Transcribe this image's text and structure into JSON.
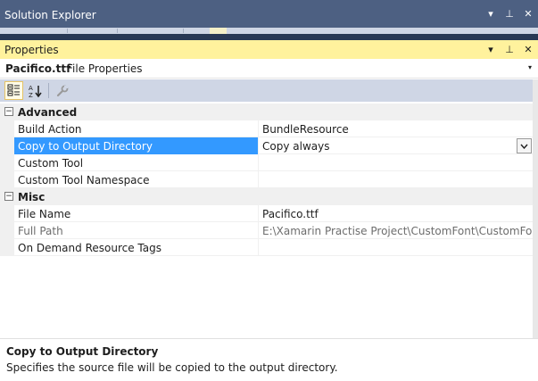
{
  "solution_explorer": {
    "title": "Solution Explorer",
    "buttons": {
      "dropdown": "▾",
      "pin": "⊥",
      "close": "✕"
    }
  },
  "properties": {
    "title": "Properties",
    "buttons": {
      "dropdown": "▾",
      "pin": "⊥",
      "close": "✕"
    },
    "object_selector": {
      "name": "Pacifico.ttf",
      "type": "File Properties",
      "arrow": "▾"
    },
    "toolbar": {
      "icons": [
        "categorized-icon",
        "alphabetical-icon",
        "property-pages-icon"
      ]
    },
    "categories": [
      {
        "label": "Advanced",
        "toggle": "−",
        "properties": [
          {
            "name": "Build Action",
            "value": "BundleResource"
          },
          {
            "name": "Copy to Output Directory",
            "value": "Copy always",
            "selected": true
          },
          {
            "name": "Custom Tool",
            "value": ""
          },
          {
            "name": "Custom Tool Namespace",
            "value": ""
          }
        ]
      },
      {
        "label": "Misc",
        "toggle": "−",
        "properties": [
          {
            "name": "File Name",
            "value": "Pacifico.ttf"
          },
          {
            "name": "Full Path",
            "value": "E:\\Xamarin Practise Project\\CustomFont\\CustomFont\\Cu",
            "disabled": true
          },
          {
            "name": "On Demand Resource Tags",
            "value": ""
          }
        ]
      }
    ],
    "description": {
      "title": "Copy to Output Directory",
      "text": "Specifies the source file will be copied to the output directory."
    }
  },
  "colors": {
    "inactive_header": "#4d6082",
    "active_header": "#fff29d",
    "selection": "#3399ff"
  }
}
